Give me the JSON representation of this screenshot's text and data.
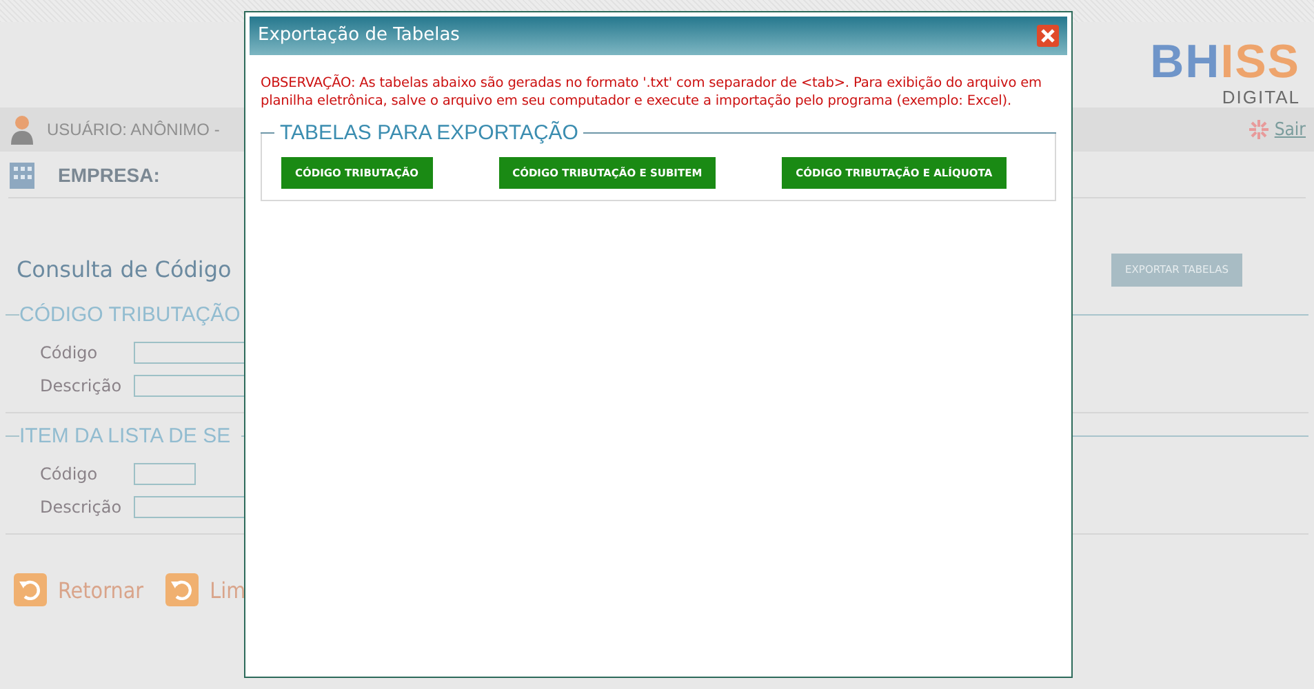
{
  "logo": {
    "brand_left": "BH",
    "brand_right": "ISS",
    "sub": "DIGITAL"
  },
  "user_bar": {
    "user": "USUÁRIO: ANÔNIMO -",
    "logout": "Sair"
  },
  "company": {
    "label": "EMPRESA:"
  },
  "page_title": "Consulta de Código",
  "export_button": "EXPORTAR TABELAS",
  "sections": [
    {
      "legend": "CÓDIGO TRIBUTAÇÃO",
      "fields": [
        {
          "label": "Código",
          "kind": "long"
        },
        {
          "label": "Descrição",
          "kind": "long"
        }
      ]
    },
    {
      "legend": "ITEM DA LISTA DE SE",
      "fields": [
        {
          "label": "Código",
          "kind": "short"
        },
        {
          "label": "Descrição",
          "kind": "long"
        }
      ]
    }
  ],
  "actions": [
    "Retornar",
    "Lim"
  ],
  "dialog": {
    "title": "Exportação de Tabelas",
    "note": "OBSERVAÇÃO: As tabelas abaixo são geradas no formato '.txt' com separador de <tab>. Para exibição do arquivo em planilha eletrônica, salve o arquivo em seu computador e execute a importação pelo programa (exemplo: Excel).",
    "legend": "TABELAS PARA EXPORTAÇÃO",
    "buttons": [
      "CÓDIGO TRIBUTAÇÃO",
      "CÓDIGO TRIBUTAÇÃO E SUBITEM",
      "CÓDIGO TRIBUTAÇÃO E ALÍQUOTA"
    ]
  }
}
